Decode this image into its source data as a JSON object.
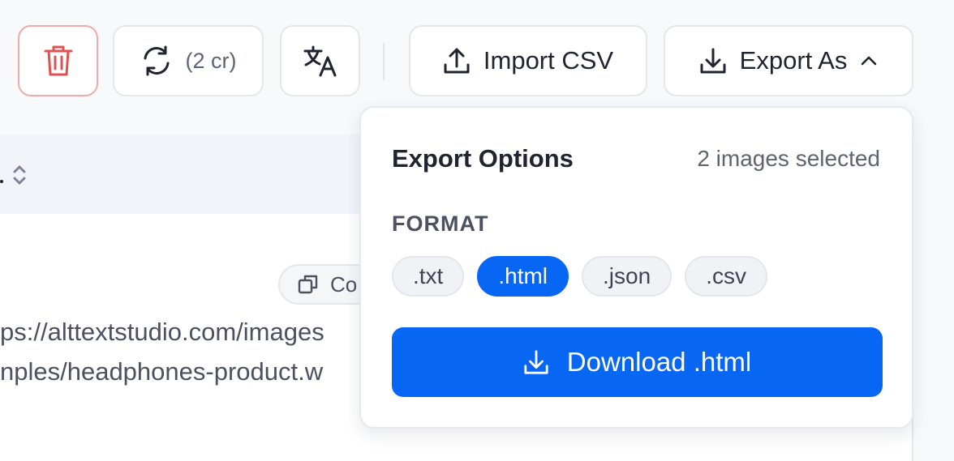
{
  "toolbar": {
    "refresh_label": "(2 cr)",
    "import_label": "Import CSV",
    "export_label": "Export As"
  },
  "table": {
    "copy_label": "Co",
    "url_line_1": "ps://alttextstudio.com/images",
    "url_line_2": "nples/headphones-product.w"
  },
  "export_panel": {
    "title": "Export Options",
    "selection_count": "2 images selected",
    "format_label": "FORMAT",
    "formats": [
      ".txt",
      ".html",
      ".json",
      ".csv"
    ],
    "selected_format": ".html",
    "download_label": "Download .html"
  },
  "icons": {
    "delete": "trash-icon",
    "refresh": "refresh-icon",
    "translate": "translate-icon",
    "import": "upload-icon",
    "export": "download-icon",
    "export_chevron": "chevron-up-icon",
    "sort": "sort-icon",
    "copy": "copy-icon",
    "download": "download-icon"
  },
  "colors": {
    "accent": "#0866f5",
    "danger": "#e05252",
    "danger_border": "#f2a9a9"
  }
}
